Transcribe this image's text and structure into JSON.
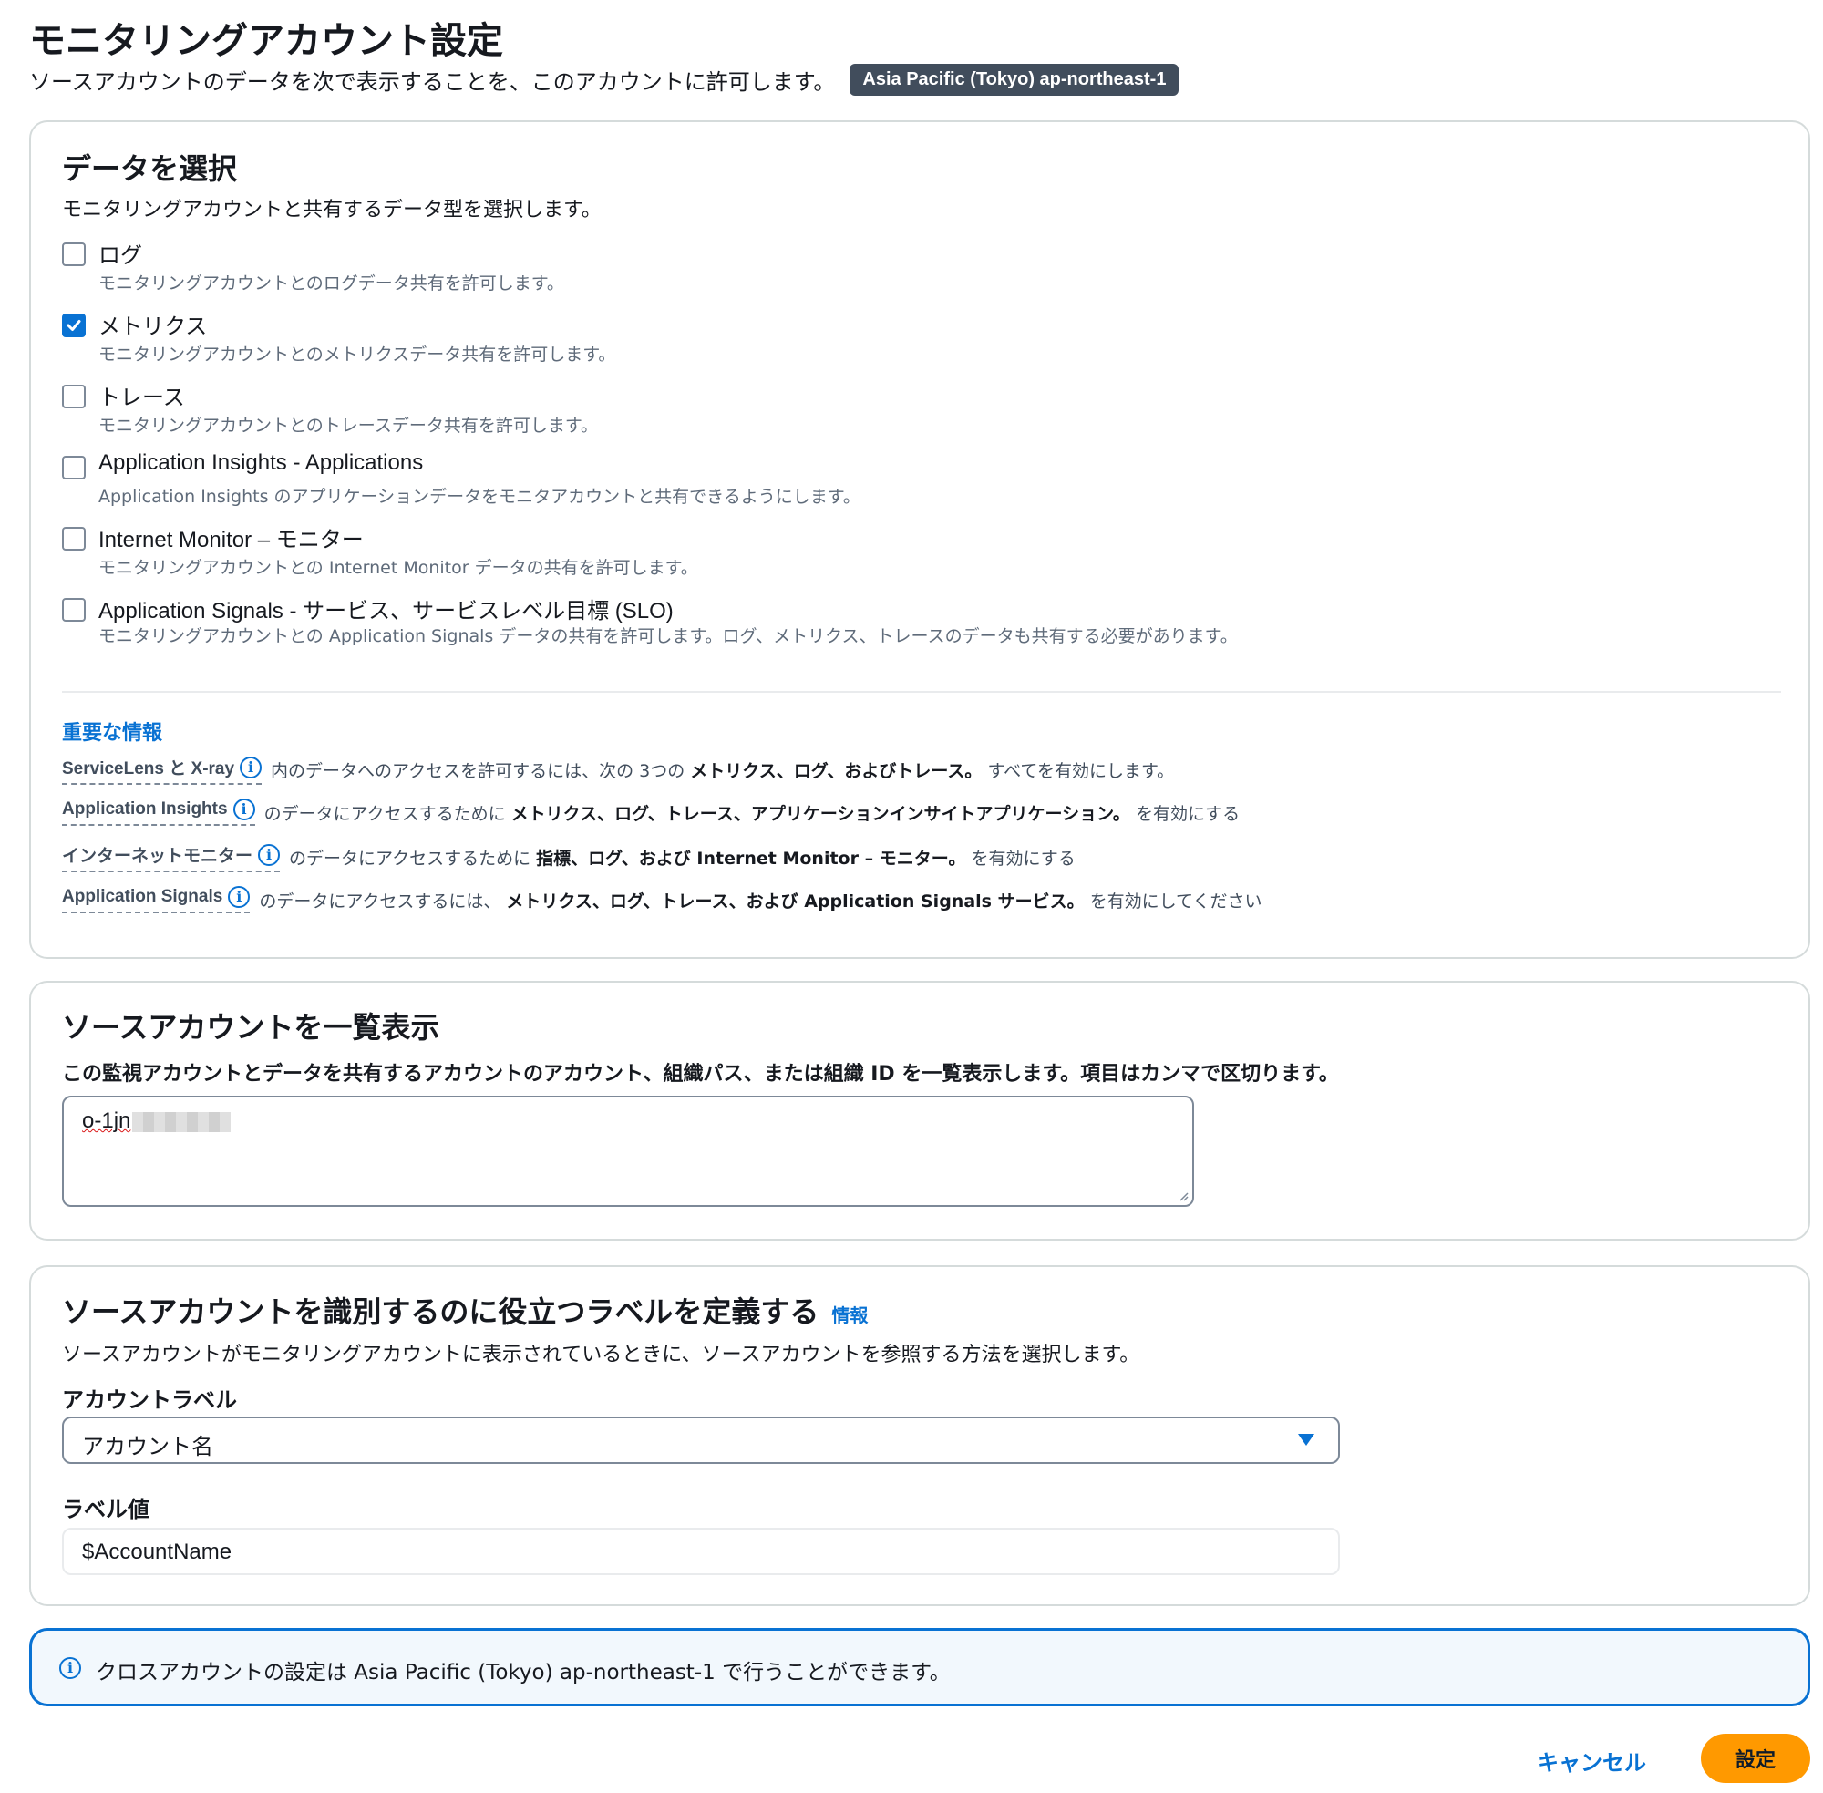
{
  "header": {
    "title": "モニタリングアカウント設定",
    "subtitle": "ソースアカウントのデータを次で表示することを、このアカウントに許可します。",
    "region_badge": "Asia Pacific (Tokyo) ap-northeast-1"
  },
  "select_data": {
    "title": "データを選択",
    "description": "モニタリングアカウントと共有するデータ型を選択します。",
    "options": [
      {
        "label": "ログ",
        "description": "モニタリングアカウントとのログデータ共有を許可します。",
        "checked": false
      },
      {
        "label": "メトリクス",
        "description": "モニタリングアカウントとのメトリクスデータ共有を許可します。",
        "checked": true
      },
      {
        "label": "トレース",
        "description": "モニタリングアカウントとのトレースデータ共有を許可します。",
        "checked": false
      },
      {
        "label": "Application Insights - Applications",
        "description": "Application Insights のアプリケーションデータをモニタアカウントと共有できるようにします。",
        "checked": false
      },
      {
        "label": "Internet Monitor – モニター",
        "description": "モニタリングアカウントとの Internet Monitor データの共有を許可します。",
        "checked": false
      },
      {
        "label": "Application Signals - サービス、サービスレベル目標 (SLO)",
        "description": "モニタリングアカウントとの Application Signals データの共有を許可します。ログ、メトリクス、トレースのデータも共有する必要があります。",
        "checked": false
      }
    ],
    "important": {
      "heading": "重要な情報",
      "rows": [
        {
          "link": "ServiceLens と X-ray",
          "pre": "内のデータへのアクセスを許可するには、次の 3つの",
          "bold": "メトリクス、ログ、およびトレース。",
          "post": "すべてを有効にします。"
        },
        {
          "link": "Application Insights",
          "pre": "のデータにアクセスするために",
          "bold": "メトリクス、ログ、トレース、アプリケーションインサイトアプリケーション。",
          "post": "を有効にする"
        },
        {
          "link": "インターネットモニター",
          "pre": "のデータにアクセスするために",
          "bold": "指標、ログ、および Internet Monitor – モニター。",
          "post": "を有効にする"
        },
        {
          "link": "Application Signals",
          "pre": "のデータにアクセスするには、",
          "bold": "メトリクス、ログ、トレース、および Application Signals サービス。",
          "post": "を有効にしてください"
        }
      ]
    }
  },
  "source_accounts": {
    "title": "ソースアカウントを一覧表示",
    "description": "この監視アカウントとデータを共有するアカウントのアカウント、組織パス、または組織 ID を一覧表示します。項目はカンマで区切ります。",
    "value": "o-1jn"
  },
  "labels": {
    "title": "ソースアカウントを識別するのに役立つラベルを定義する",
    "info_link": "情報",
    "description": "ソースアカウントがモニタリングアカウントに表示されているときに、ソースアカウントを参照する方法を選択します。",
    "account_label_title": "アカウントラベル",
    "account_label_value": "アカウント名",
    "label_value_title": "ラベル値",
    "label_value": "$AccountName"
  },
  "alert": {
    "icon": "info-icon",
    "text": "クロスアカウントの設定は Asia Pacific (Tokyo) ap-northeast-1 で行うことができます。"
  },
  "footer": {
    "cancel": "キャンセル",
    "submit": "設定"
  },
  "colors": {
    "accent": "#0972d3",
    "primary_button": "#ff9900",
    "badge": "#414d5c"
  }
}
